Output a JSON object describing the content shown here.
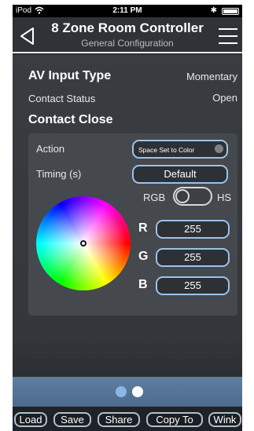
{
  "status_bar": {
    "carrier": "iPod",
    "time": "2:11 PM",
    "bluetooth": "✱"
  },
  "header": {
    "title": "8 Zone Room Controller",
    "subtitle": "General Configuration",
    "back_icon": "back-chevron-icon",
    "menu_icon": "hamburger-menu-icon"
  },
  "av_input": {
    "label": "AV Input Type",
    "value": "Momentary"
  },
  "contact_status": {
    "label": "Contact Status",
    "value": "Open"
  },
  "contact_close": {
    "heading": "Contact Close",
    "action": {
      "label": "Action",
      "value": "Space Set to Color"
    },
    "timing": {
      "label": "Timing (s)",
      "value": "Default"
    },
    "color_mode": {
      "left": "RGB",
      "right": "HS",
      "selected": "RGB"
    },
    "color": {
      "r": {
        "label": "R",
        "value": "255"
      },
      "g": {
        "label": "G",
        "value": "255"
      },
      "b": {
        "label": "B",
        "value": "255"
      }
    }
  },
  "pager": {
    "pages": 2,
    "current": 1,
    "active_color": "#8ab8e6",
    "inactive_color": "#ffffff"
  },
  "toolbar": {
    "load": "Load",
    "save": "Save",
    "share": "Share",
    "copy_to": "Copy To",
    "wink": "Wink"
  }
}
